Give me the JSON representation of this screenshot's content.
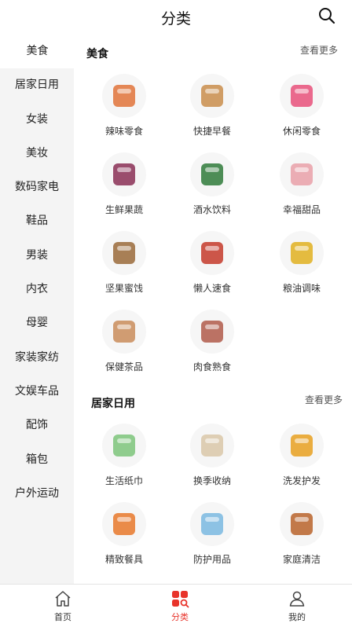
{
  "header": {
    "title": "分类"
  },
  "sidebar": {
    "items": [
      "美食",
      "居家日用",
      "女装",
      "美妆",
      "数码家电",
      "鞋品",
      "男装",
      "内衣",
      "母婴",
      "家装家纺",
      "文娱车品",
      "配饰",
      "箱包",
      "户外运动"
    ],
    "active_index": 0
  },
  "sections": [
    {
      "title": "美食",
      "more": "查看更多",
      "items": [
        {
          "label": "辣味零食",
          "icon": "spicy-snack-icon",
          "color": "#e0733a"
        },
        {
          "label": "快捷早餐",
          "icon": "bread-icon",
          "color": "#c98d4b"
        },
        {
          "label": "休闲零食",
          "icon": "snack-bag-icon",
          "color": "#e8507a"
        },
        {
          "label": "生鲜果蔬",
          "icon": "fruit-icon",
          "color": "#8a2f55"
        },
        {
          "label": "酒水饮料",
          "icon": "drinks-icon",
          "color": "#2f7a3a"
        },
        {
          "label": "幸福甜品",
          "icon": "macaron-icon",
          "color": "#e9a0a8"
        },
        {
          "label": "坚果蜜饯",
          "icon": "nuts-icon",
          "color": "#9a6a3a"
        },
        {
          "label": "懒人速食",
          "icon": "instant-noodle-icon",
          "color": "#c43a2a"
        },
        {
          "label": "粮油调味",
          "icon": "cooking-oil-icon",
          "color": "#e0b020"
        },
        {
          "label": "保健茶品",
          "icon": "tea-icon",
          "color": "#c98c5a"
        },
        {
          "label": "肉食熟食",
          "icon": "meat-icon",
          "color": "#b05a4a"
        }
      ]
    },
    {
      "title": "居家日用",
      "more": "查看更多",
      "items": [
        {
          "label": "生活纸巾",
          "icon": "tissue-icon",
          "color": "#7cc47a"
        },
        {
          "label": "换季收纳",
          "icon": "storage-box-icon",
          "color": "#d9c7a8"
        },
        {
          "label": "洗发护发",
          "icon": "shampoo-icon",
          "color": "#e8a020"
        },
        {
          "label": "精致餐具",
          "icon": "pot-icon",
          "color": "#e8782a"
        },
        {
          "label": "防护用品",
          "icon": "mask-icon",
          "color": "#7ab8e0"
        },
        {
          "label": "家庭清洁",
          "icon": "cleaner-icon",
          "color": "#b8632a"
        }
      ]
    }
  ],
  "tabbar": {
    "items": [
      {
        "label": "首页",
        "icon": "home-icon"
      },
      {
        "label": "分类",
        "icon": "category-icon"
      },
      {
        "label": "我的",
        "icon": "user-icon"
      }
    ],
    "active_index": 1,
    "accent": "#e8332a"
  }
}
